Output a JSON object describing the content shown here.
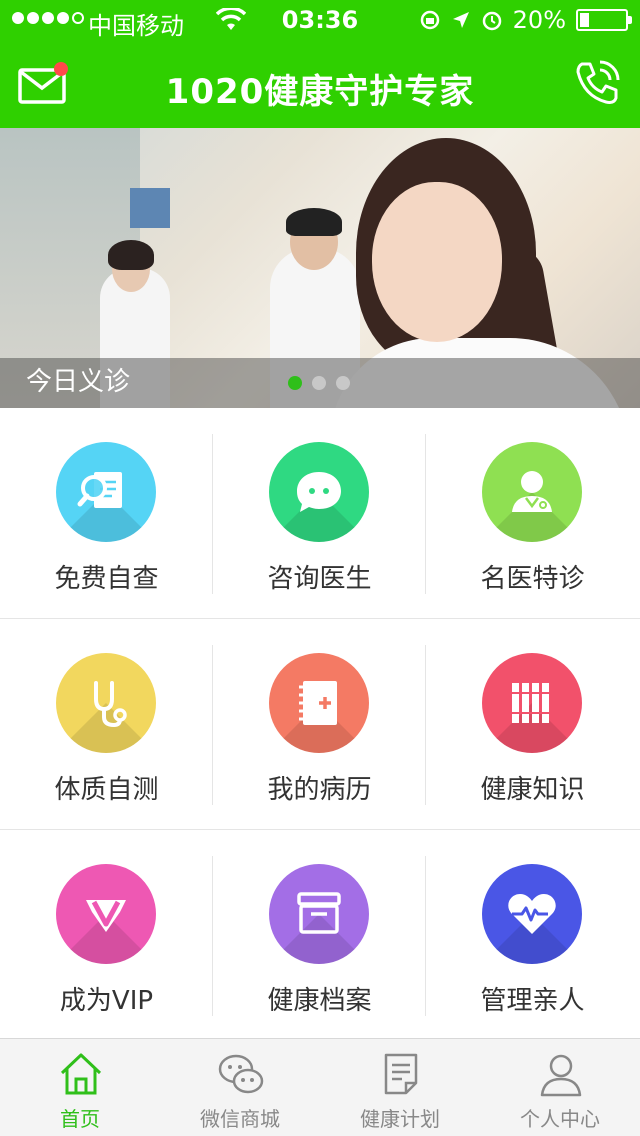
{
  "status_bar": {
    "carrier": "中国移动",
    "time": "03:36",
    "battery": "20%",
    "battery_level": 0.2
  },
  "header": {
    "title": "1020健康守护专家",
    "mail_icon": "mail-icon",
    "phone_icon": "phone-icon"
  },
  "banner": {
    "caption": "今日义诊",
    "slides": 3,
    "active_slide": 1
  },
  "grid": {
    "items": [
      {
        "label": "免费自查",
        "icon": "search-document-icon",
        "color": "#55d4f5"
      },
      {
        "label": "咨询医生",
        "icon": "chat-bubble-icon",
        "color": "#2fd982"
      },
      {
        "label": "名医特诊",
        "icon": "doctor-icon",
        "color": "#8fe052"
      },
      {
        "label": "体质自测",
        "icon": "stethoscope-icon",
        "color": "#f2d75e"
      },
      {
        "label": "我的病历",
        "icon": "medical-record-icon",
        "color": "#f47a64"
      },
      {
        "label": "健康知识",
        "icon": "books-icon",
        "color": "#f2516b"
      },
      {
        "label": "成为VIP",
        "icon": "vip-diamond-icon",
        "color": "#ee58b3"
      },
      {
        "label": "健康档案",
        "icon": "archive-box-icon",
        "color": "#a36ee6"
      },
      {
        "label": "管理亲人",
        "icon": "heart-pulse-icon",
        "color": "#4a56e6"
      }
    ]
  },
  "tabbar": {
    "tabs": [
      {
        "label": "首页",
        "icon": "home-icon",
        "active": true
      },
      {
        "label": "微信商城",
        "icon": "wechat-icon",
        "active": false
      },
      {
        "label": "健康计划",
        "icon": "document-icon",
        "active": false
      },
      {
        "label": "个人中心",
        "icon": "user-icon",
        "active": false
      }
    ]
  },
  "colors": {
    "brand_green": "#2fd000",
    "active_tab": "#2fbf1a"
  }
}
